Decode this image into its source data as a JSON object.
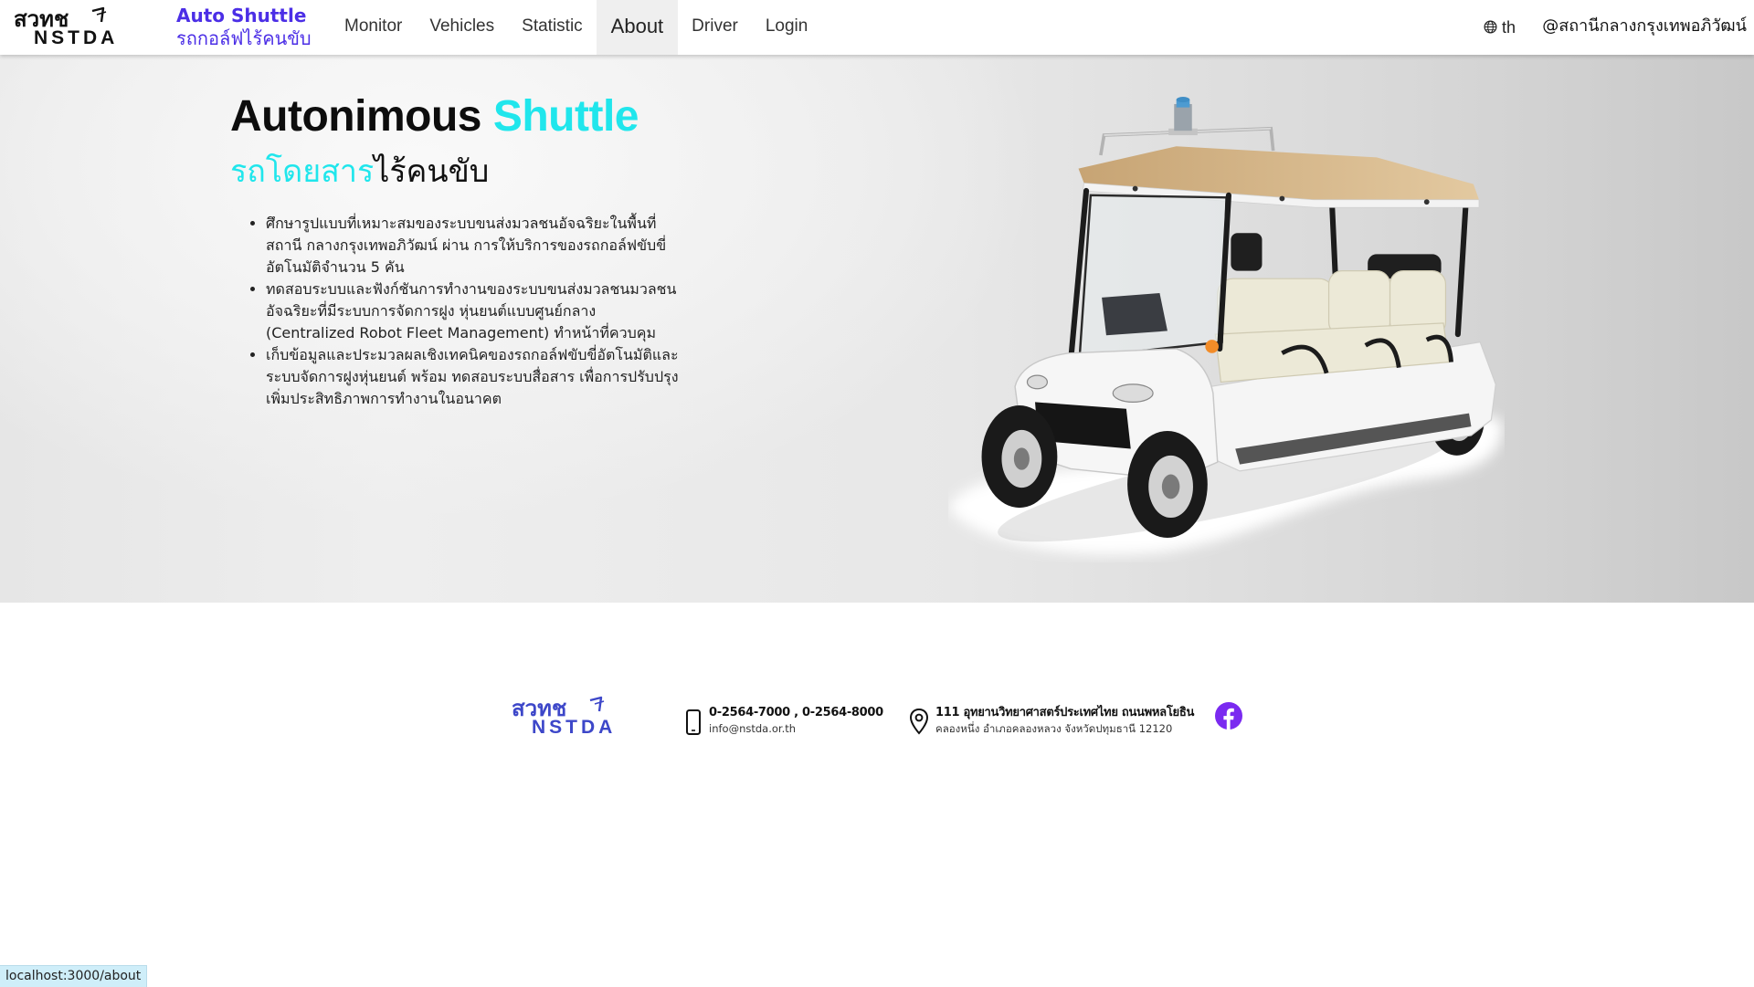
{
  "colors": {
    "accent_cyan": "#20e6ec",
    "brand_purple": "#4b2ee6",
    "footer_logo_blue": "#3d47c9",
    "facebook_purple": "#7a2af0",
    "active_nav_bg": "#efefef"
  },
  "header": {
    "logo": {
      "thai": "สวทช",
      "latin": "NSTDA"
    },
    "brand": {
      "title": "Auto Shuttle",
      "subtitle": "รถกอล์ฟไร้คนขับ"
    },
    "nav": [
      {
        "label": "Monitor",
        "active": false
      },
      {
        "label": "Vehicles",
        "active": false
      },
      {
        "label": "Statistic",
        "active": false
      },
      {
        "label": "About",
        "active": true
      },
      {
        "label": "Driver",
        "active": false
      },
      {
        "label": "Login",
        "active": false
      }
    ],
    "language": {
      "icon": "globe-icon",
      "label": "th"
    },
    "station": "@สถานีกลางกรุงเทพอภิวัฒน์"
  },
  "hero": {
    "title": {
      "main": "Autonimous",
      "accent": "Shuttle"
    },
    "subtitle": {
      "accent": "รถโดยสาร",
      "main": "ไร้คนขับ"
    },
    "bullets": [
      "ศึกษารูปแบบที่เหมาะสมของระบบขนส่งมวลชนอัจฉริยะในพื้นที่สถานี กลางกรุงเทพอภิวัฒน์ ผ่าน การให้บริการของรถกอล์ฟขับขี่อัตโนมัติจำนวน 5 คัน",
      "ทดสอบระบบและฟังก์ชันการทำงานของระบบขนส่งมวลชนมวลชนอัจฉริยะที่มีระบบการจัดการฝูง หุ่นยนต์แบบศูนย์กลาง (Centralized Robot Fleet Management) ทำหน้าที่ควบคุม",
      "เก็บข้อมูลและประมวลผลเชิงเทคนิคของรถกอล์ฟขับขี่อัตโนมัติและระบบจัดการฝูงหุ่นยนต์ พร้อม ทดสอบระบบสื่อสาร เพื่อการปรับปรุงเพิ่มประสิทธิภาพการทำงานในอนาคต"
    ],
    "image": {
      "icon": "shuttle-cart-image"
    }
  },
  "footer": {
    "logo": {
      "thai": "สวทช",
      "latin": "NSTDA"
    },
    "contact": {
      "icon": "mobile-phone-icon",
      "phones": "0-2564-7000 , 0-2564-8000",
      "email": "info@nstda.or.th"
    },
    "address": {
      "icon": "location-pin-icon",
      "line1": "111 อุทยานวิทยาศาสตร์ประเทศไทย ถนนพหลโยธิน",
      "line2": "คลองหนึ่ง อำเภอคลองหลวง จังหวัดปทุมธานี 12120"
    },
    "social": {
      "icon": "facebook-icon"
    }
  },
  "status_bar": {
    "url": "localhost:3000/about"
  }
}
